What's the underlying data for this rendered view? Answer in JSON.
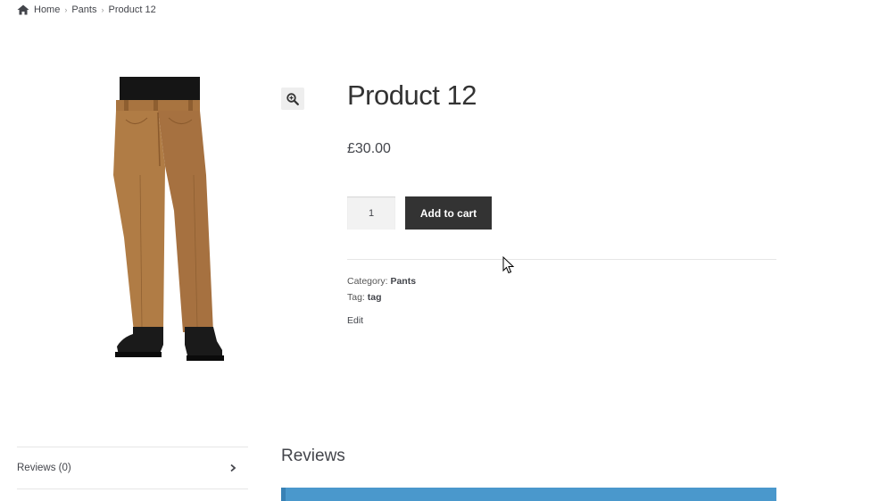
{
  "breadcrumb": {
    "icon": "home-icon",
    "home": "Home",
    "category": "Pants",
    "current": "Product 12"
  },
  "product": {
    "title": "Product 12",
    "price": "£30.00",
    "quantity": "1",
    "add_to_cart_label": "Add to cart",
    "zoom_icon": "magnifier-zoom-icon",
    "image_icon": "brown-pants-image"
  },
  "meta": {
    "category_label": "Category:",
    "category_value": "Pants",
    "tag_label": "Tag:",
    "tag_value": "tag",
    "edit_label": "Edit"
  },
  "tabs": [
    {
      "label": "Reviews (0)"
    }
  ],
  "reviews": {
    "heading": "Reviews"
  },
  "colors": {
    "button_bg": "#333333",
    "notice_bg": "#4a98cc",
    "pants": "#b07c45"
  }
}
